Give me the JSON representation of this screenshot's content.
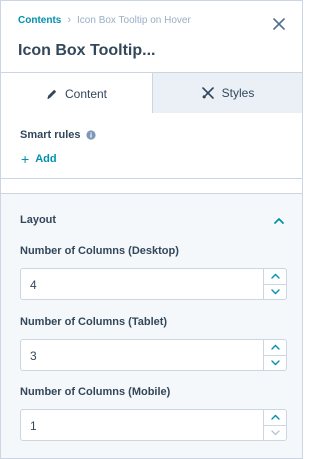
{
  "header": {
    "breadcrumb_link": "Contents",
    "breadcrumb_separator": "›",
    "breadcrumb_current": "Icon Box Tooltip on Hover",
    "title": "Icon Box Tooltip...",
    "close_icon": "close-icon"
  },
  "tabs": [
    {
      "label": "Content",
      "icon": "pencil-icon",
      "active": true
    },
    {
      "label": "Styles",
      "icon": "brush-icon",
      "active": false
    }
  ],
  "smart_rules": {
    "label": "Smart rules",
    "info_icon": "info-icon",
    "add_label": "Add"
  },
  "layout": {
    "title": "Layout",
    "expanded": true,
    "fields": [
      {
        "label": "Number of Columns (Desktop)",
        "value": "4"
      },
      {
        "label": "Number of Columns (Tablet)",
        "value": "3"
      },
      {
        "label": "Number of Columns (Mobile)",
        "value": "1"
      }
    ]
  },
  "colors": {
    "accent": "#0091ae",
    "text": "#33475b",
    "muted": "#99afc4",
    "border": "#cbd6e2",
    "panel_bg": "#f5f8fa"
  }
}
